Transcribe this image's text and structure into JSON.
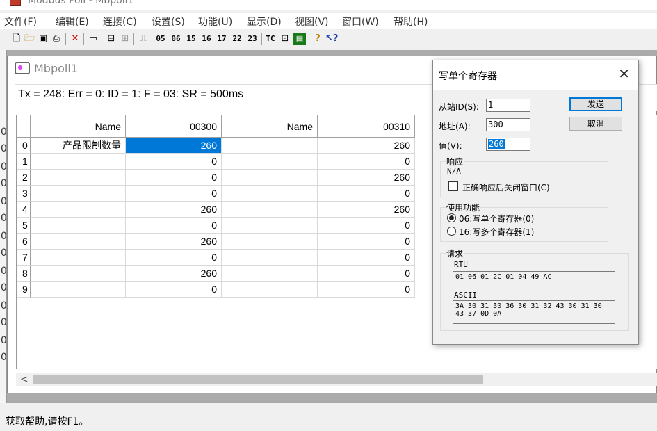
{
  "app": {
    "title": "Modbus Poll - Mbpoll1"
  },
  "menu": [
    "文件(F)",
    "编辑(E)",
    "连接(C)",
    "设置(S)",
    "功能(U)",
    "显示(D)",
    "视图(V)",
    "窗口(W)",
    "帮助(H)"
  ],
  "toolbar": {
    "icons": [
      "new-icon",
      "open-icon",
      "save-icon",
      "print-icon",
      "delete-icon",
      "window-icon",
      "connect-icon",
      "disconnect-icon",
      "pulse-icon",
      "traffic-icon",
      "chart-icon",
      "help-icon",
      "context-help-icon"
    ],
    "function_codes": [
      "05",
      "06",
      "15",
      "16",
      "17",
      "22",
      "23"
    ],
    "tc_label": "TC"
  },
  "child_window": {
    "title": "Mbpoll1",
    "status_line": "Tx = 248: Err = 0: ID = 1: F = 03: SR = 500ms"
  },
  "grid": {
    "columns": [
      "Name",
      "00300",
      "Name",
      "00310"
    ],
    "rows": [
      {
        "idx": "0",
        "name1": "产品限制数量",
        "v1": "260",
        "name2": "",
        "v2": "260"
      },
      {
        "idx": "1",
        "name1": "",
        "v1": "0",
        "name2": "",
        "v2": "0"
      },
      {
        "idx": "2",
        "name1": "",
        "v1": "0",
        "name2": "",
        "v2": "260"
      },
      {
        "idx": "3",
        "name1": "",
        "v1": "0",
        "name2": "",
        "v2": "0"
      },
      {
        "idx": "4",
        "name1": "",
        "v1": "260",
        "name2": "",
        "v2": "260"
      },
      {
        "idx": "5",
        "name1": "",
        "v1": "0",
        "name2": "",
        "v2": "0"
      },
      {
        "idx": "6",
        "name1": "",
        "v1": "260",
        "name2": "",
        "v2": "0"
      },
      {
        "idx": "7",
        "name1": "",
        "v1": "0",
        "name2": "",
        "v2": "0"
      },
      {
        "idx": "8",
        "name1": "",
        "v1": "260",
        "name2": "",
        "v2": "0"
      },
      {
        "idx": "9",
        "name1": "",
        "v1": "0",
        "name2": "",
        "v2": "0"
      }
    ]
  },
  "statusbar": {
    "text": "获取帮助,请按F1。"
  },
  "dialog": {
    "title": "写单个寄存器",
    "slave_label": "从站ID(S):",
    "slave_value": "1",
    "address_label": "地址(A):",
    "address_value": "300",
    "value_label": "值(V):",
    "value_value": "260",
    "send_label": "发送",
    "cancel_label": "取消",
    "response_group": "响应",
    "response_text": "N/A",
    "close_checkbox": "正确响应后关闭窗口(C)",
    "func_group": "使用功能",
    "func_06": "06:写单个寄存器(0)",
    "func_16": "16:写多个寄存器(1)",
    "request_group": "请求",
    "rtu_label": "RTU",
    "rtu_value": "01 06 01 2C 01 04 49 AC",
    "ascii_label": "ASCII",
    "ascii_value": "3A 30 31 30 36 30 31 32 43 30 31 30 43 37 0D 0A"
  }
}
